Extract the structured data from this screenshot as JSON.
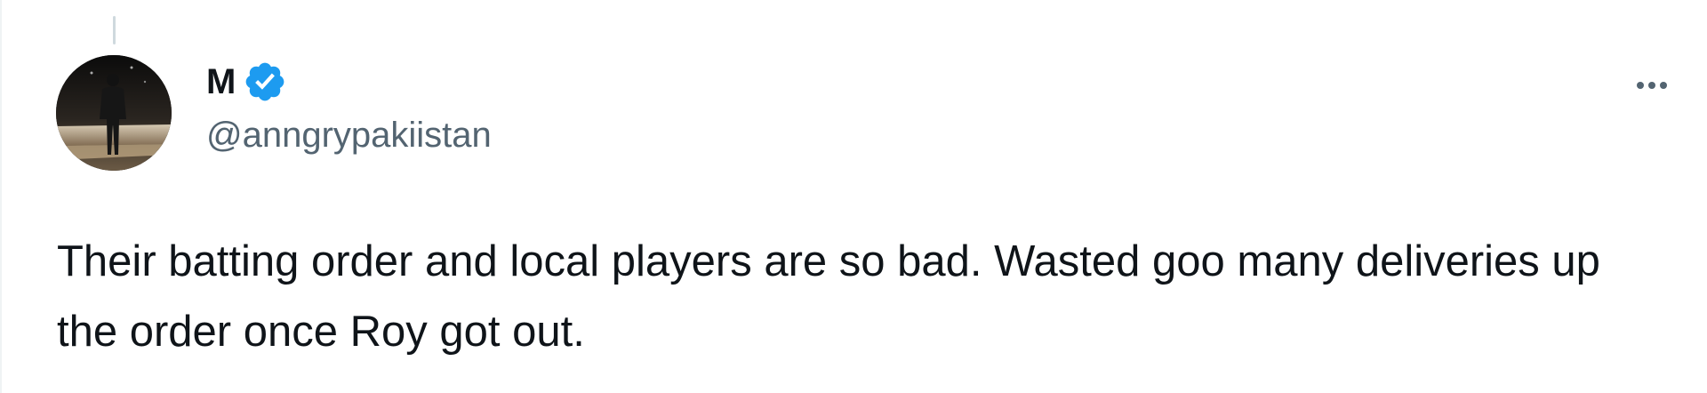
{
  "tweet": {
    "display_name": "M",
    "handle": "@anngrypakiistan",
    "verified": true,
    "text": "Their batting order and local players are so bad. Wasted goo many deliveries up the order once Roy got out.",
    "icons": {
      "verified": "verified-badge-icon",
      "more": "more-options-icon"
    },
    "colors": {
      "verified_badge": "#1d9bf0",
      "handle": "#536471",
      "text": "#0f1419"
    }
  }
}
